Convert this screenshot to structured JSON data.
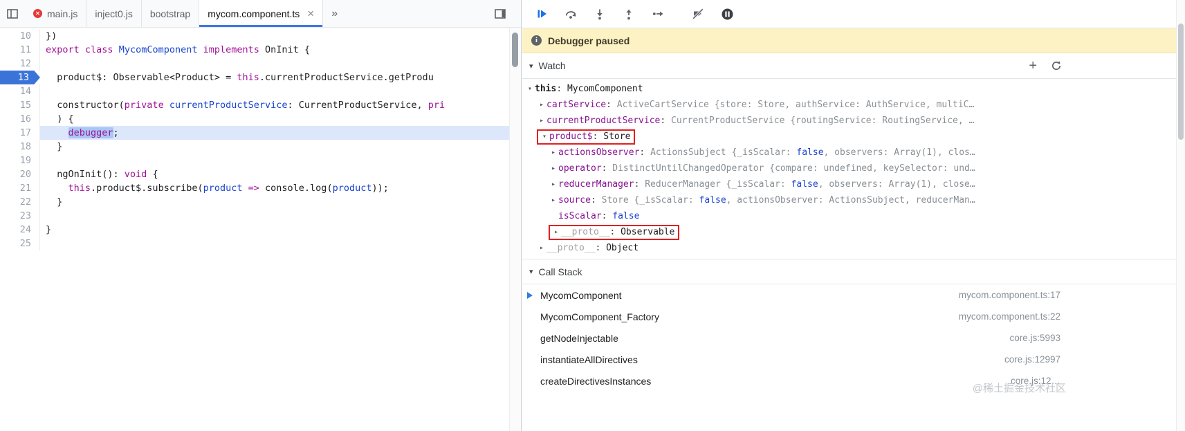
{
  "meta": {
    "watermark": "@稀土掘金技术社区"
  },
  "colors": {
    "accent_blue": "#3b78e7",
    "breakpoint_blue": "#3b74d9",
    "annotation_red": "#e02020",
    "paused_bg": "#fdf2c4"
  },
  "tabbar": {
    "tabs": [
      {
        "label": "main.js",
        "error": true,
        "active": false,
        "closable": false
      },
      {
        "label": "inject0.js",
        "error": false,
        "active": false,
        "closable": false
      },
      {
        "label": "bootstrap",
        "error": false,
        "active": false,
        "closable": false
      },
      {
        "label": "mycom.component.ts",
        "error": false,
        "active": true,
        "closable": true
      }
    ],
    "overflow": "»"
  },
  "editor": {
    "breakpoint_line": 13,
    "execution_line": 17,
    "lines": [
      {
        "n": "10",
        "seg": [
          [
            "p",
            "})"
          ]
        ]
      },
      {
        "n": "11",
        "seg": [
          [
            "k",
            "export"
          ],
          [
            "p",
            " "
          ],
          [
            "k",
            "class"
          ],
          [
            "p",
            " "
          ],
          [
            "d",
            "MycomComponent"
          ],
          [
            "p",
            " "
          ],
          [
            "k",
            "implements"
          ],
          [
            "p",
            " OnInit {"
          ]
        ]
      },
      {
        "n": "12",
        "seg": []
      },
      {
        "n": "13",
        "bp": true,
        "seg": [
          [
            "p",
            "  product$: Observable<Product> = "
          ],
          [
            "k",
            "this"
          ],
          [
            "p",
            ".currentProductService.getProdu"
          ]
        ]
      },
      {
        "n": "14",
        "seg": []
      },
      {
        "n": "15",
        "seg": [
          [
            "p",
            "  constructor("
          ],
          [
            "k",
            "private"
          ],
          [
            "p",
            " "
          ],
          [
            "d",
            "currentProductService"
          ],
          [
            "p",
            ": CurrentProductService, "
          ],
          [
            "k",
            "pri"
          ]
        ]
      },
      {
        "n": "16",
        "seg": [
          [
            "p",
            "  ) {"
          ]
        ]
      },
      {
        "n": "17",
        "exec": true,
        "seg": [
          [
            "p",
            "    "
          ],
          [
            "kx",
            "debugger"
          ],
          [
            "p",
            ";"
          ]
        ]
      },
      {
        "n": "18",
        "seg": [
          [
            "p",
            "  }"
          ]
        ]
      },
      {
        "n": "19",
        "seg": []
      },
      {
        "n": "20",
        "seg": [
          [
            "p",
            "  ngOnInit(): "
          ],
          [
            "k",
            "void"
          ],
          [
            "p",
            " {"
          ]
        ]
      },
      {
        "n": "21",
        "seg": [
          [
            "p",
            "    "
          ],
          [
            "k",
            "this"
          ],
          [
            "p",
            ".product$.subscribe("
          ],
          [
            "d",
            "product"
          ],
          [
            "p",
            " "
          ],
          [
            "k",
            "=>"
          ],
          [
            "p",
            " console.log("
          ],
          [
            "d",
            "product"
          ],
          [
            "p",
            "));"
          ]
        ]
      },
      {
        "n": "22",
        "seg": [
          [
            "p",
            "  }"
          ]
        ]
      },
      {
        "n": "23",
        "seg": []
      },
      {
        "n": "24",
        "seg": [
          [
            "p",
            "}"
          ]
        ]
      },
      {
        "n": "25",
        "seg": []
      }
    ]
  },
  "debugger": {
    "toolbar_icons": [
      "resume",
      "step-over",
      "step-into",
      "step-out",
      "step",
      "deactivate-breakpoints",
      "pause-on-exceptions"
    ],
    "paused_message": "Debugger paused",
    "watch_title": "Watch",
    "watch_rows": [
      {
        "lvl": 0,
        "tri": "open",
        "name": "this",
        "name_style": "plain",
        "val": [
          [
            "cls",
            "MycomComponent"
          ]
        ]
      },
      {
        "lvl": 1,
        "tri": "closed",
        "name": "cartService",
        "name_style": "prop",
        "val": [
          [
            "gr",
            "ActiveCartService {store: Store, authService: AuthService, multiC…"
          ]
        ]
      },
      {
        "lvl": 1,
        "tri": "closed",
        "name": "currentProductService",
        "name_style": "prop",
        "val": [
          [
            "gr",
            "CurrentProductService {routingService: RoutingService, …"
          ]
        ]
      },
      {
        "lvl": 1,
        "tri": "open",
        "name": "product$",
        "name_style": "prop",
        "val": [
          [
            "cls",
            "Store"
          ]
        ],
        "boxed": true
      },
      {
        "lvl": 2,
        "tri": "closed",
        "name": "actionsObserver",
        "name_style": "prop",
        "val": [
          [
            "gr",
            "ActionsSubject {_isScalar: "
          ],
          [
            "bool",
            "false"
          ],
          [
            "gr",
            ", observers: Array(1), clos…"
          ]
        ]
      },
      {
        "lvl": 2,
        "tri": "closed",
        "name": "operator",
        "name_style": "prop",
        "val": [
          [
            "gr",
            "DistinctUntilChangedOperator {compare: undefined, keySelector: und…"
          ]
        ]
      },
      {
        "lvl": 2,
        "tri": "closed",
        "name": "reducerManager",
        "name_style": "prop",
        "val": [
          [
            "gr",
            "ReducerManager {_isScalar: "
          ],
          [
            "bool",
            "false"
          ],
          [
            "gr",
            ", observers: Array(1), close…"
          ]
        ]
      },
      {
        "lvl": 2,
        "tri": "closed",
        "name": "source",
        "name_style": "prop",
        "val": [
          [
            "gr",
            "Store {_isScalar: "
          ],
          [
            "bool",
            "false"
          ],
          [
            "gr",
            ", actionsObserver: ActionsSubject, reducerMan…"
          ]
        ]
      },
      {
        "lvl": 2,
        "tri": "none",
        "name": "isScalar",
        "name_style": "prop",
        "val": [
          [
            "bool",
            "false"
          ]
        ]
      },
      {
        "lvl": 2,
        "tri": "closed",
        "name": "__proto__",
        "name_style": "dim",
        "val": [
          [
            "cls",
            "Observable"
          ]
        ],
        "boxed": true
      },
      {
        "lvl": 1,
        "tri": "closed",
        "name": "__proto__",
        "name_style": "dim",
        "val": [
          [
            "cls",
            "Object"
          ]
        ]
      }
    ],
    "callstack_title": "Call Stack",
    "frames": [
      {
        "fn": "MycomComponent",
        "loc": "mycom.component.ts:17",
        "current": true
      },
      {
        "fn": "MycomComponent_Factory",
        "loc": "mycom.component.ts:22",
        "current": false
      },
      {
        "fn": "getNodeInjectable",
        "loc": "core.js:5993",
        "current": false
      },
      {
        "fn": "instantiateAllDirectives",
        "loc": "core.js:12997",
        "current": false
      },
      {
        "fn": "createDirectivesInstances",
        "loc": "core.js:12…",
        "current": false
      }
    ]
  }
}
